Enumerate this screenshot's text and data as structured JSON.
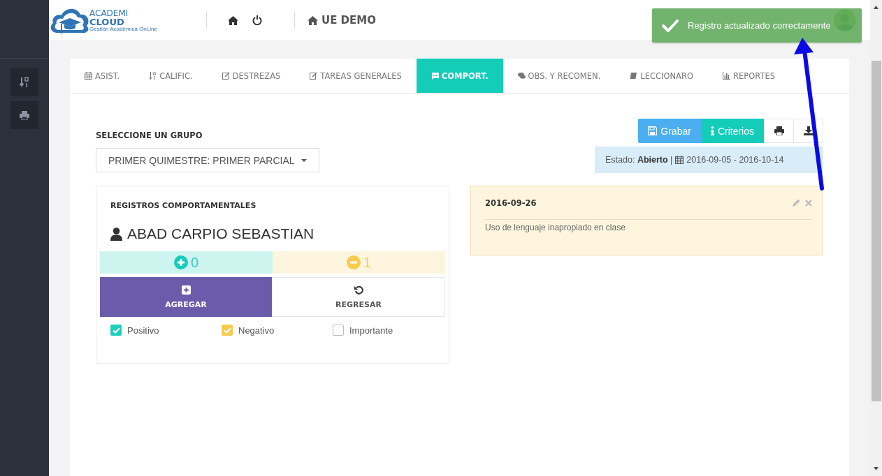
{
  "logo": {
    "line1": "ACADEMI",
    "line2": "CLOUD",
    "tagline": "Gestión Académica OnLine"
  },
  "header": {
    "institution": "UE DEMO"
  },
  "toast": {
    "message": "Registro actualizado correctamente"
  },
  "tabs": [
    {
      "label": "ASIST.",
      "selected": false
    },
    {
      "label": "CALIFIC.",
      "selected": false
    },
    {
      "label": "DESTREZAS",
      "selected": false
    },
    {
      "label": "TAREAS GENERALES",
      "selected": false
    },
    {
      "label": "COMPORT.",
      "selected": true
    },
    {
      "label": "OBS. Y RECOMEN.",
      "selected": false
    },
    {
      "label": "LECCIONARO",
      "selected": false
    },
    {
      "label": "REPORTES",
      "selected": false
    }
  ],
  "group": {
    "label": "SELECCIONE UN GRUPO",
    "value": "PRIMER QUIMESTRE: PRIMER PARCIAL"
  },
  "toolbar": {
    "save": "Grabar",
    "criteria": "Criterios"
  },
  "status": {
    "text": "Estado: **Abierto** |",
    "range": "2016-09-05 - 2016-10-14"
  },
  "panel": {
    "title": "REGISTROS COMPORTAMENTALES",
    "student": "ABAD CARPIO SEBASTIAN",
    "counters": [
      {
        "kind": "positive",
        "value": "0"
      },
      {
        "kind": "negative",
        "value": "1"
      }
    ],
    "add": "AGREGAR",
    "back": "REGRESAR",
    "options": [
      {
        "label": "Positivo",
        "checked": true,
        "color": "#1dcfbc"
      },
      {
        "label": "Negativo",
        "checked": true,
        "color": "#f8cb4e"
      },
      {
        "label": "Importante",
        "checked": false
      }
    ]
  },
  "record": {
    "date": "2016-09-26",
    "text": "Uso de lenguaje inapropiado en clase"
  }
}
